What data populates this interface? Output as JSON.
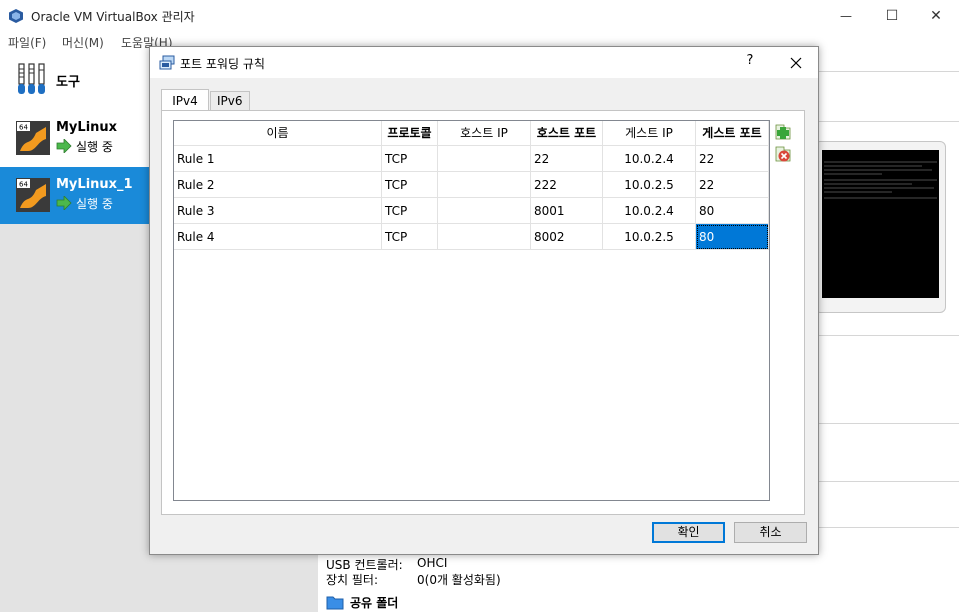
{
  "window": {
    "title": "Oracle VM VirtualBox 관리자",
    "minimize_glyph": "—",
    "maximize_glyph": "☐",
    "close_glyph": "✕"
  },
  "menu": [
    {
      "label": "파일(F)"
    },
    {
      "label": "머신(M)"
    },
    {
      "label": "도움말(H)"
    }
  ],
  "sidebar": {
    "tools_label": "도구",
    "vms": [
      {
        "name": "MyLinux",
        "state": "실행 중",
        "badge": "64",
        "selected": false
      },
      {
        "name": "MyLinux_1",
        "state": "실행 중",
        "badge": "64",
        "selected": true
      }
    ]
  },
  "details": {
    "usb_controller_label": "USB 컨트롤러:",
    "usb_controller_value": "OHCI",
    "device_filter_label": "장치 필터:",
    "device_filter_value": "0(0개 활성화됨)",
    "shared_folders_label": "공유 폴더"
  },
  "dialog": {
    "title": "포트 포워딩 규칙",
    "help": "?",
    "tabs": [
      {
        "label": "IPv4",
        "active": true
      },
      {
        "label": "IPv6",
        "active": false
      }
    ],
    "columns": [
      {
        "label": "이름"
      },
      {
        "label": "프로토콜"
      },
      {
        "label": "호스트 IP"
      },
      {
        "label": "호스트 포트"
      },
      {
        "label": "게스트 IP"
      },
      {
        "label": "게스트 포트"
      }
    ],
    "rules": [
      {
        "name": "Rule 1",
        "protocol": "TCP",
        "host_ip": "",
        "host_port": "22",
        "guest_ip": "10.0.2.4",
        "guest_port": "22"
      },
      {
        "name": "Rule 2",
        "protocol": "TCP",
        "host_ip": "",
        "host_port": "222",
        "guest_ip": "10.0.2.5",
        "guest_port": "22"
      },
      {
        "name": "Rule 3",
        "protocol": "TCP",
        "host_ip": "",
        "host_port": "8001",
        "guest_ip": "10.0.2.4",
        "guest_port": "80"
      },
      {
        "name": "Rule 4",
        "protocol": "TCP",
        "host_ip": "",
        "host_port": "8002",
        "guest_ip": "10.0.2.5",
        "guest_port": "80"
      }
    ],
    "selected_cell": {
      "row": 3,
      "column": "guest_port"
    },
    "ok_label": "확인",
    "cancel_label": "취소"
  },
  "colors": {
    "selection": "#0078d7",
    "vm_selected": "#1a8ad9",
    "add_icon": "#3aa63a",
    "remove_icon": "#d9483b"
  }
}
